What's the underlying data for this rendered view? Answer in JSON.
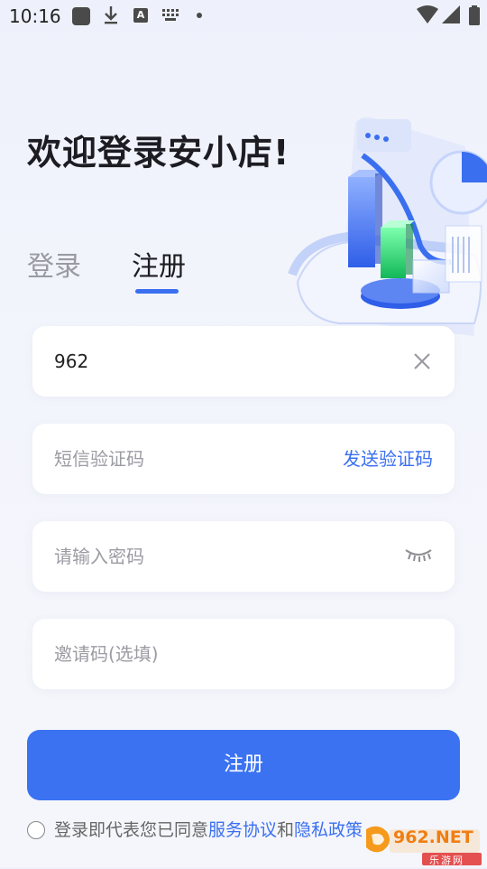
{
  "status_bar": {
    "time": "10:16",
    "a_icon_label": "A"
  },
  "header": {
    "title": "欢迎登录安小店!"
  },
  "tabs": [
    {
      "label": "登录",
      "active": false
    },
    {
      "label": "注册",
      "active": true
    }
  ],
  "form": {
    "phone": {
      "value": "962"
    },
    "sms": {
      "placeholder": "短信验证码",
      "send_label": "发送验证码"
    },
    "password": {
      "placeholder": "请输入密码"
    },
    "invite": {
      "placeholder": "邀请码(选填)"
    },
    "submit_label": "注册"
  },
  "agreement": {
    "prefix": "登录即代表您已同意",
    "service_link": "服务协议",
    "and": "和",
    "privacy_link": "隐私政策"
  },
  "watermark": {
    "logo_text": "962.NET",
    "sub_text": "乐游网"
  },
  "colors": {
    "accent": "#3a72f2",
    "link": "#3a6ff0",
    "text": "#1c1c22",
    "placeholder": "#9b9ba3"
  }
}
